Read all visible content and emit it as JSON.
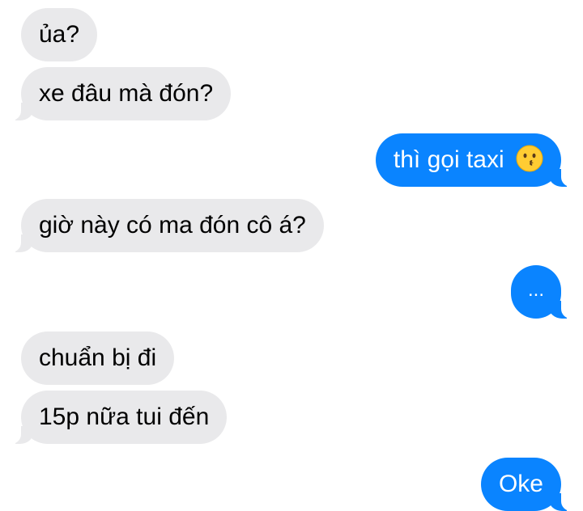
{
  "conversation": {
    "messages": [
      {
        "sender": "other",
        "text": "ủa?"
      },
      {
        "sender": "other",
        "text": "xe đâu mà đón?"
      },
      {
        "sender": "me",
        "text": "thì gọi taxi",
        "emoji": "kissing-face-emoji"
      },
      {
        "sender": "other",
        "text": "giờ này có ma đón cô á?"
      },
      {
        "sender": "me",
        "text": "..."
      },
      {
        "sender": "other",
        "text": "chuẩn bị đi"
      },
      {
        "sender": "other",
        "text": "15p nữa tui đến"
      },
      {
        "sender": "me",
        "text": "Oke"
      }
    ]
  },
  "colors": {
    "incoming_bubble": "#e9e9eb",
    "outgoing_bubble": "#0a84ff",
    "incoming_text": "#000000",
    "outgoing_text": "#ffffff",
    "background": "#ffffff"
  }
}
